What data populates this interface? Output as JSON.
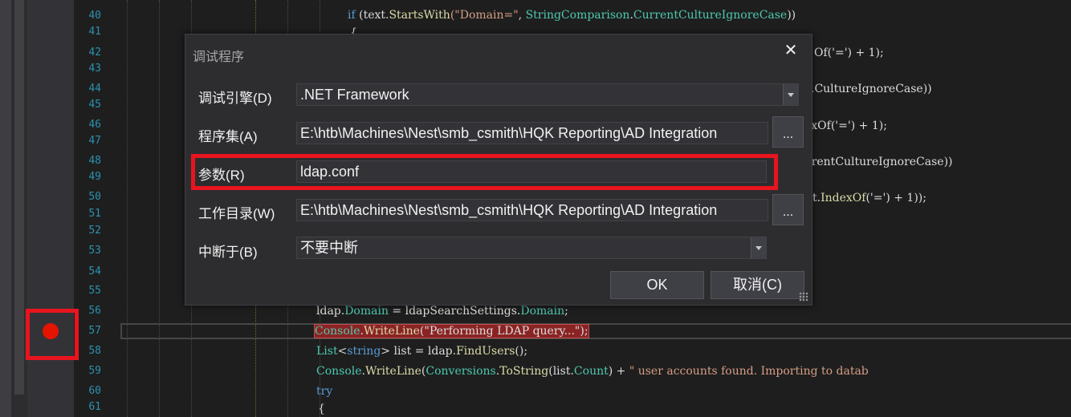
{
  "editor": {
    "line_numbers": [
      "40",
      "41",
      "42",
      "43",
      "44",
      "45",
      "46",
      "47",
      "48",
      "49",
      "50",
      "51",
      "52",
      "53",
      "54",
      "55",
      "56",
      "57",
      "58",
      "59",
      "60",
      "61"
    ],
    "code": {
      "l40": [
        "if",
        " (text.",
        "StartsWith",
        "(\"Domain=\"",
        ", ",
        "StringComparison",
        ".",
        "CurrentCultureIgnoreCase",
        "))"
      ],
      "l41": "{",
      "l42_tail": "Of('=') + 1);",
      "l44_tail": ".CultureIgnoreCase))",
      "l46_tail": "exOf('=') + 1);",
      "l48_tail": "rrentCultureIgnoreCase))",
      "l50_tail": [
        "t.",
        "IndexOf",
        "('=') + 1));"
      ],
      "l56": [
        "ldap.",
        "Domain",
        " = ldapSearchSettings.",
        "Domain",
        ";"
      ],
      "l57": [
        "Console",
        ".",
        "WriteLine",
        "(\"Performing LDAP query...\");"
      ],
      "l58": [
        "List",
        "<",
        "string",
        "> list = ldap.",
        "FindUsers",
        "();"
      ],
      "l59": [
        "Console",
        ".",
        "WriteLine",
        "(",
        "Conversions",
        ".",
        "ToString",
        "(list.",
        "Count",
        ") + ",
        "\" user accounts found. Importing to datab"
      ],
      "l60": "try",
      "l61": "{"
    }
  },
  "dialog": {
    "title": "调试程序",
    "close_glyph": "✕",
    "fields": {
      "engine_label": "调试引擎(D)",
      "engine_value": ".NET Framework",
      "assembly_label": "程序集(A)",
      "assembly_value": "E:\\htb\\Machines\\Nest\\smb_csmith\\HQK Reporting\\AD Integration",
      "args_label": "参数(R)",
      "args_value": "ldap.conf",
      "workdir_label": "工作目录(W)",
      "workdir_value": "E:\\htb\\Machines\\Nest\\smb_csmith\\HQK Reporting\\AD Integration",
      "break_label": "中断于(B)",
      "break_value": "不要中断",
      "browse_label": "..."
    },
    "ok_label": "OK",
    "cancel_label": "取消(C)"
  },
  "colors": {
    "breakpoint": "#e51400",
    "highlight_box": "#e8141e",
    "keyword": "#569cd6",
    "type": "#4ec9b0",
    "method": "#dcdcaa",
    "string": "#d69d85"
  }
}
